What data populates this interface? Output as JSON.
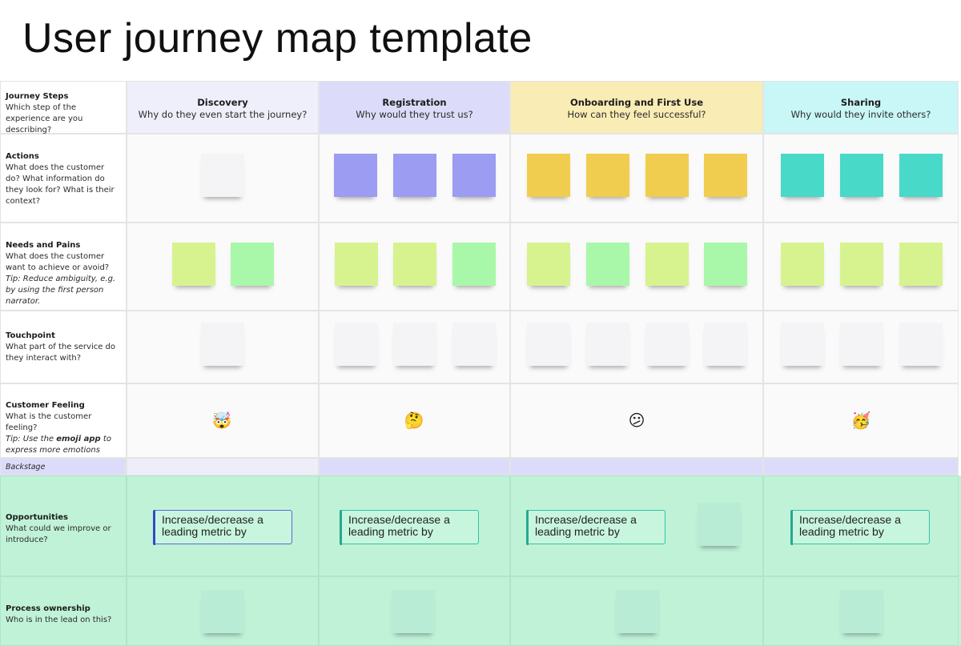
{
  "page": {
    "title": "User journey map template"
  },
  "header": {
    "label": {
      "title": "Journey Steps",
      "desc": "Which step of the experience are you describing?"
    },
    "stages": [
      {
        "title": "Discovery",
        "question": "Why do they even start the journey?",
        "color": "#efeefb"
      },
      {
        "title": "Registration",
        "question": "Why would they trust us?",
        "color": "#dcdcfa"
      },
      {
        "title": "Onboarding and First Use",
        "question": "How can they feel successful?",
        "color": "#f9ecb4"
      },
      {
        "title": "Sharing",
        "question": "Why would they invite others?",
        "color": "#c9f6f6"
      }
    ]
  },
  "rows": {
    "actions": {
      "title": "Actions",
      "desc": "What does the customer do? What information do they look for? What is their context?"
    },
    "needs": {
      "title": "Needs and Pains",
      "desc": "What does the customer want to achieve or avoid?",
      "tip": "Tip: Reduce ambiguity, e.g. by using the first person narrator."
    },
    "touchpoint": {
      "title": "Touchpoint",
      "desc": "What part of the service do they interact with?"
    },
    "feeling": {
      "title": "Customer Feeling",
      "desc": "What is the customer feeling?",
      "tip_prefix": "Tip: Use the ",
      "tip_bold": "emoji app",
      "tip_suffix": " to express more emotions"
    },
    "backstage": {
      "title": "Backstage"
    },
    "opportunities": {
      "title": "Opportunities",
      "desc": "What could we improve or introduce?"
    },
    "ownership": {
      "title": "Process ownership",
      "desc": "Who is in the lead on this?"
    }
  },
  "emojis": [
    "🤯",
    "🤔",
    "😕",
    "🥳"
  ],
  "emoji_icons": [
    "exploding-head-emoji-icon",
    "thinking-face-emoji-icon",
    "confused-face-emoji-icon",
    "partying-face-emoji-icon"
  ],
  "metric_card_text": "Increase/decrease a leading metric by",
  "metric_cards": [
    {
      "text": "Increase/decrease a leading metric by"
    },
    {
      "text": "Increase/decrease a leading metric by"
    },
    {
      "text": "Increase/decrease a leading metric by"
    },
    {
      "text": "Increase/decrease a leading metric by"
    }
  ],
  "colors": {
    "backstage_band": "#dcdcfa",
    "green_zone": "#c0f2d8",
    "sticky_purple": "#9c9cf2",
    "sticky_yellow": "#f0cd4e",
    "sticky_teal": "#48d9c9",
    "sticky_lime": "#d7f38f",
    "sticky_green": "#a9f8a9"
  }
}
